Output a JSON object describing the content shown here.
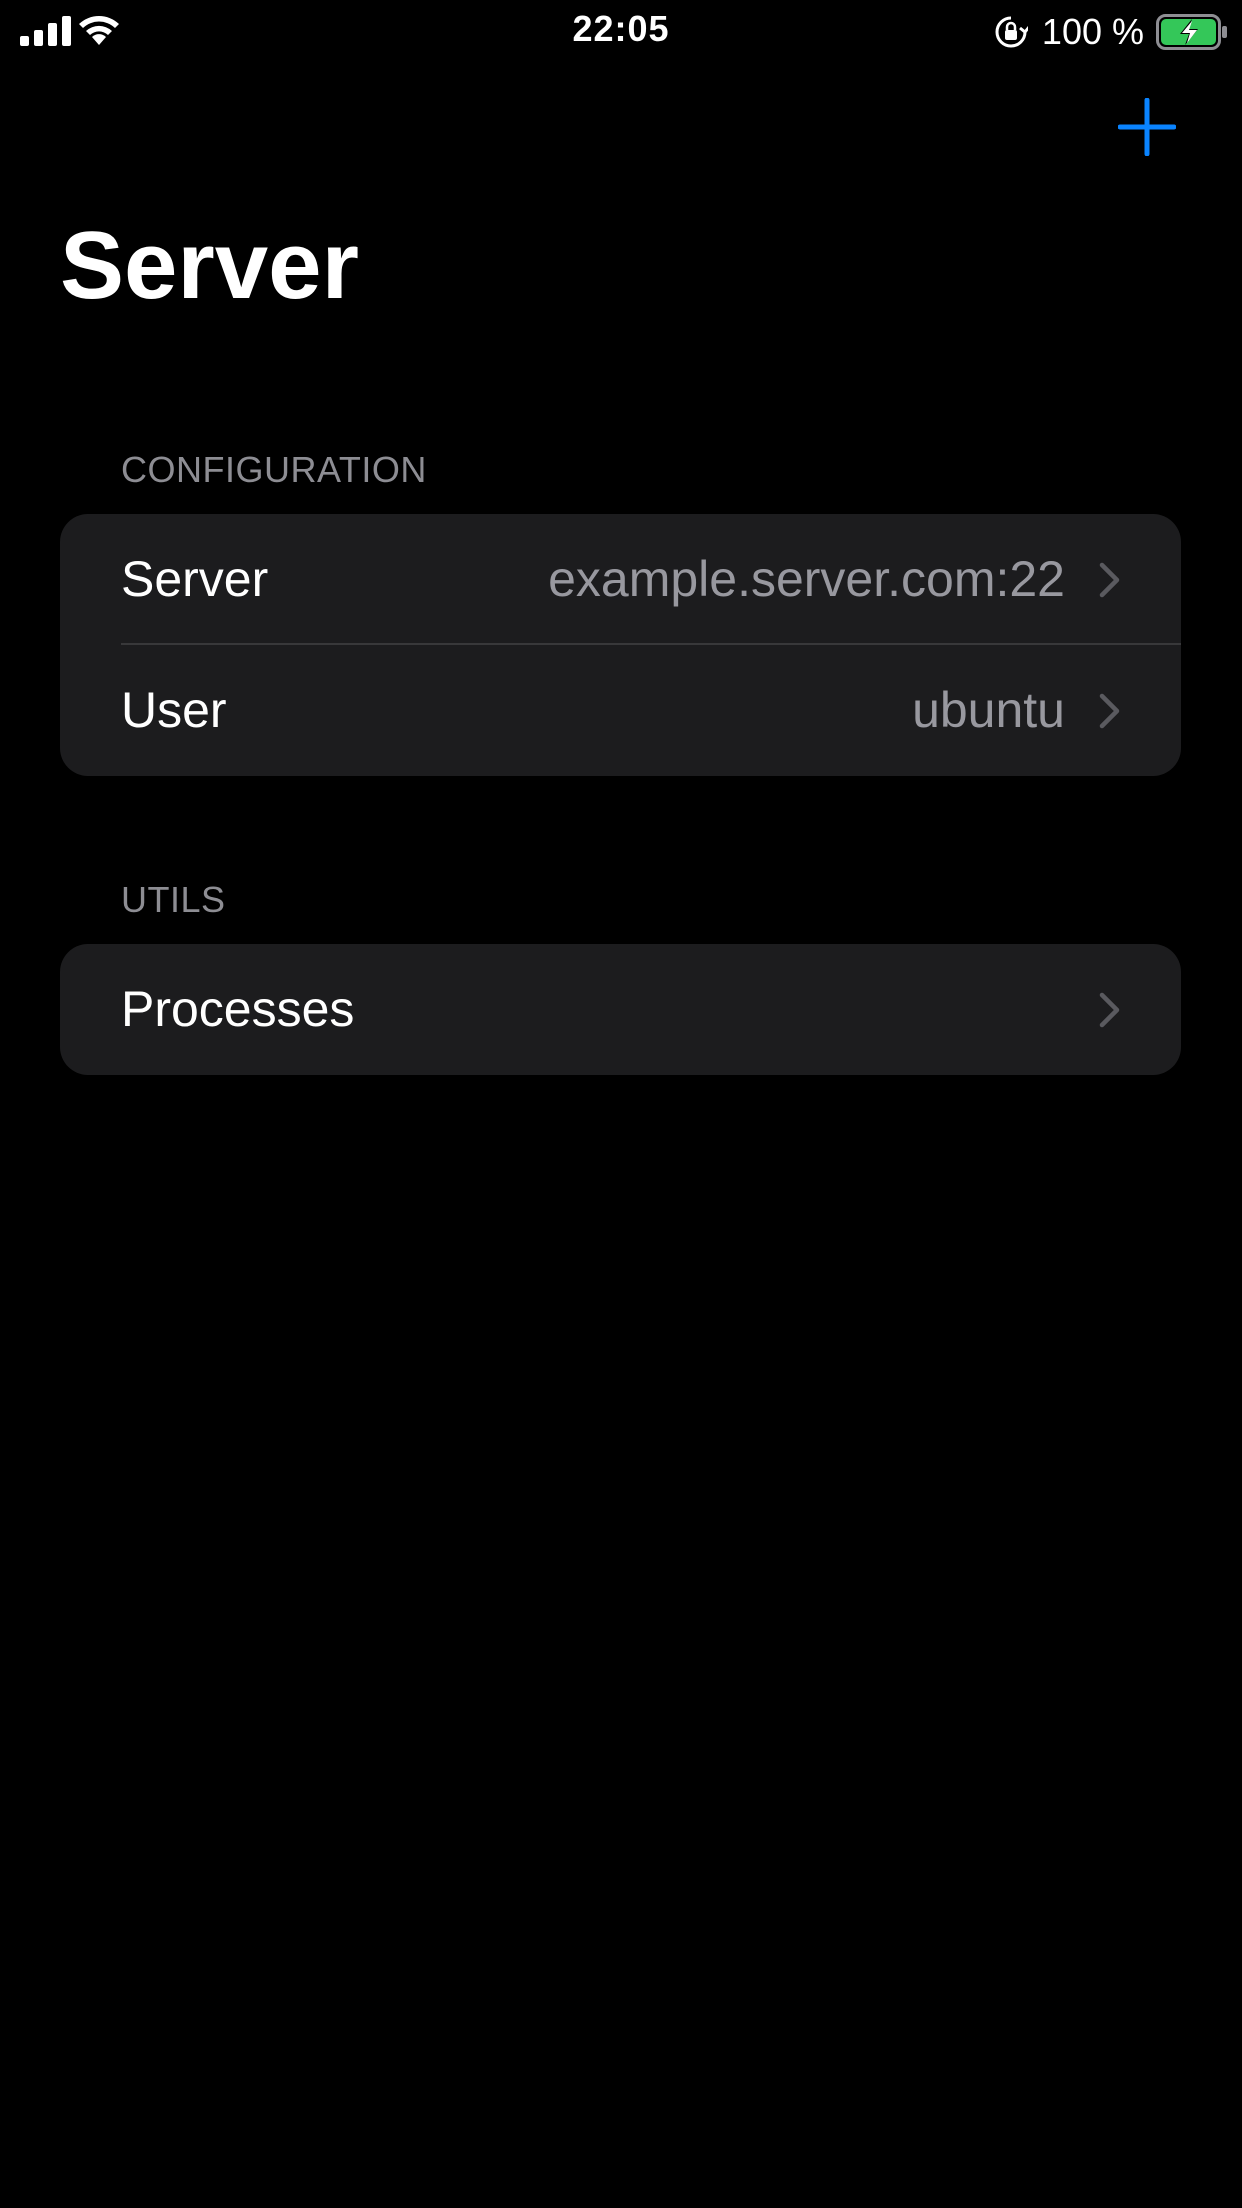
{
  "status_bar": {
    "time": "22:05",
    "battery_percent": "100 %",
    "battery_level": 1.0,
    "icons": [
      "cellular-signal-icon",
      "wifi-icon",
      "orientation-lock-icon",
      "battery-charging-icon"
    ]
  },
  "nav": {
    "title": "Server",
    "add_icon": "plus-icon"
  },
  "sections": {
    "configuration": {
      "header": "CONFIGURATION",
      "rows": [
        {
          "label": "Server",
          "value": "example.server.com:22"
        },
        {
          "label": "User",
          "value": "ubuntu"
        }
      ]
    },
    "utils": {
      "header": "UTILS",
      "rows": [
        {
          "label": "Processes",
          "value": ""
        }
      ]
    }
  },
  "colors": {
    "background": "#000000",
    "card": "#1c1c1e",
    "accent": "#0a84ff",
    "secondary_text": "#98989f",
    "section_header": "#8d8d93",
    "battery_fill": "#34c759"
  }
}
